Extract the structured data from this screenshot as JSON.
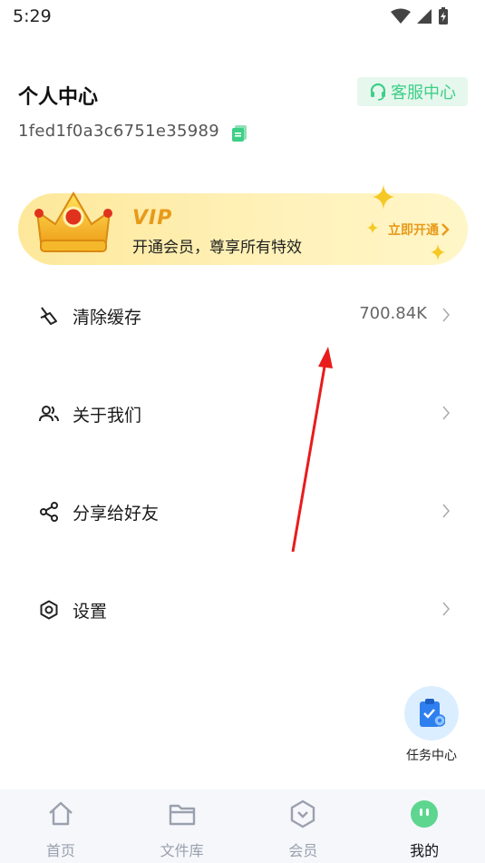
{
  "status_bar": {
    "time": "5:29"
  },
  "header": {
    "title": "个人中心",
    "user_id": "1fed1f0a3c6751e35989",
    "service_label": "客服中心"
  },
  "vip": {
    "badge": "VIP",
    "description": "开通会员，尊享所有特效",
    "cta": "立即开通"
  },
  "menu": [
    {
      "label": "清除缓存",
      "value": "700.84K",
      "icon": "broom-icon"
    },
    {
      "label": "关于我们",
      "value": "",
      "icon": "users-icon"
    },
    {
      "label": "分享给好友",
      "value": "",
      "icon": "share-icon"
    },
    {
      "label": "设置",
      "value": "",
      "icon": "settings-icon"
    }
  ],
  "task_center": {
    "label": "任务中心"
  },
  "bottom_nav": [
    {
      "label": "首页",
      "icon": "home-icon",
      "active": false
    },
    {
      "label": "文件库",
      "icon": "folder-icon",
      "active": false
    },
    {
      "label": "会员",
      "icon": "shield-icon",
      "active": false
    },
    {
      "label": "我的",
      "icon": "profile-face-icon",
      "active": true
    }
  ],
  "colors": {
    "accent_green": "#3ecf86",
    "vip_gold": "#e89a1a",
    "annotation_red": "#e81c1c"
  }
}
